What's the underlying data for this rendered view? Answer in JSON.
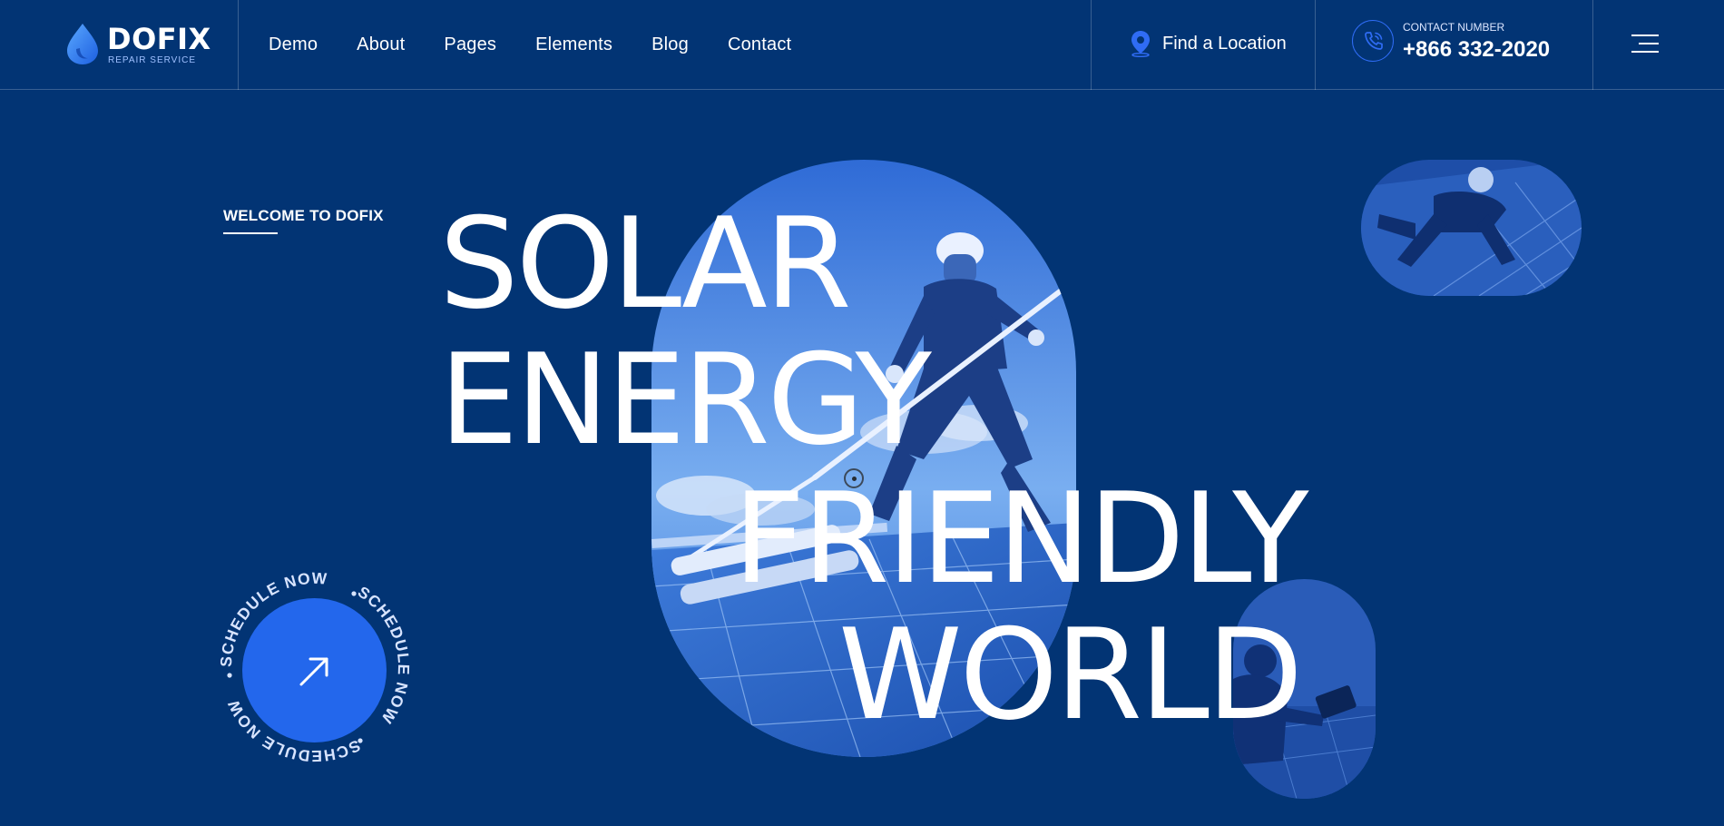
{
  "brand": {
    "name": "DOFIX",
    "tagline": "REPAIR SERVICE"
  },
  "nav": {
    "items": [
      {
        "label": "Demo"
      },
      {
        "label": "About"
      },
      {
        "label": "Pages"
      },
      {
        "label": "Elements"
      },
      {
        "label": "Blog"
      },
      {
        "label": "Contact"
      }
    ]
  },
  "header": {
    "location_label": "Find a Location",
    "contact_label": "CONTACT NUMBER",
    "contact_number": "+866 332-2020"
  },
  "hero": {
    "welcome": "WELCOME TO DOFIX",
    "headline": [
      "SOLAR",
      "ENERGY",
      "FRIENDLY",
      "WORLD"
    ],
    "schedule_text": "SCHEDULE NOW"
  },
  "colors": {
    "background": "#023474",
    "accent": "#2367ec",
    "text": "#ffffff"
  },
  "icons": [
    "water-drop-logo-icon",
    "location-pin-icon",
    "phone-call-icon",
    "hamburger-menu-icon",
    "arrow-up-right-icon"
  ]
}
